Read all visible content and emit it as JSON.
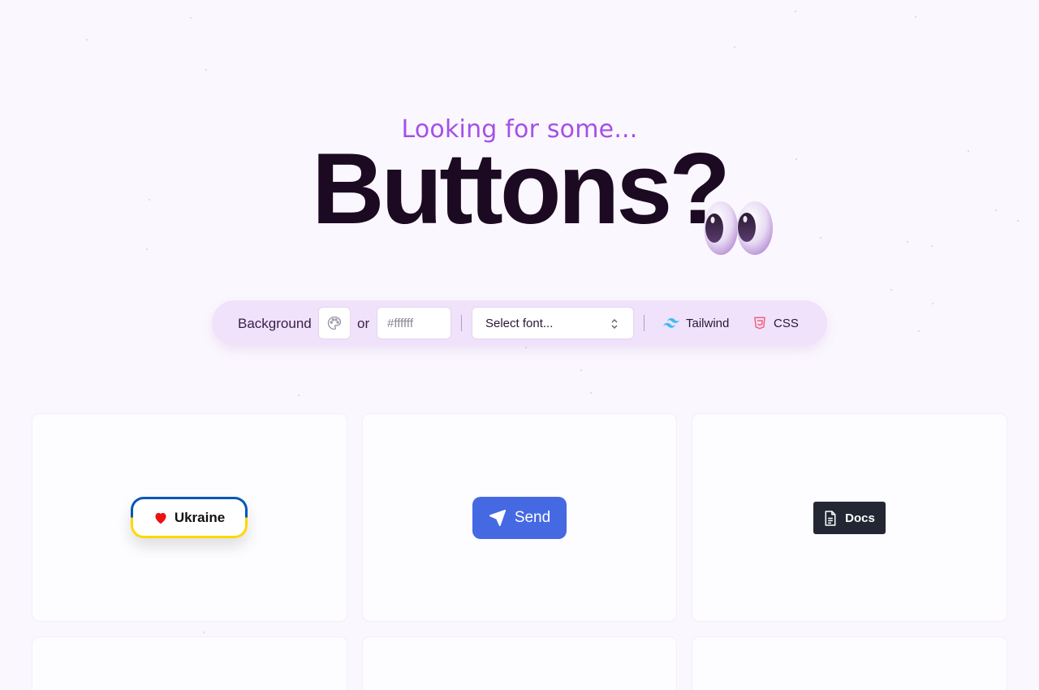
{
  "hero": {
    "subtitle": "Looking for some...",
    "title": "Buttons?"
  },
  "toolbar": {
    "background_label": "Background",
    "palette_icon": "palette-icon",
    "or_label": "or",
    "hex_placeholder": "#ffffff",
    "font_select_label": "Select font...",
    "tailwind_label": "Tailwind",
    "css_label": "CSS"
  },
  "buttons": {
    "ukraine": {
      "label": "Ukraine",
      "icon": "heart-icon"
    },
    "send": {
      "label": "Send",
      "icon": "paper-plane-icon"
    },
    "docs": {
      "label": "Docs",
      "icon": "document-icon"
    }
  },
  "colors": {
    "page_bg": "#fbf7fe",
    "accent": "#a450e8",
    "toolbar_bg": "#f0e2fb",
    "send_bg": "#4569e3",
    "docs_bg": "#232733",
    "ukraine_blue": "#0057b7",
    "ukraine_yellow": "#ffd700"
  }
}
